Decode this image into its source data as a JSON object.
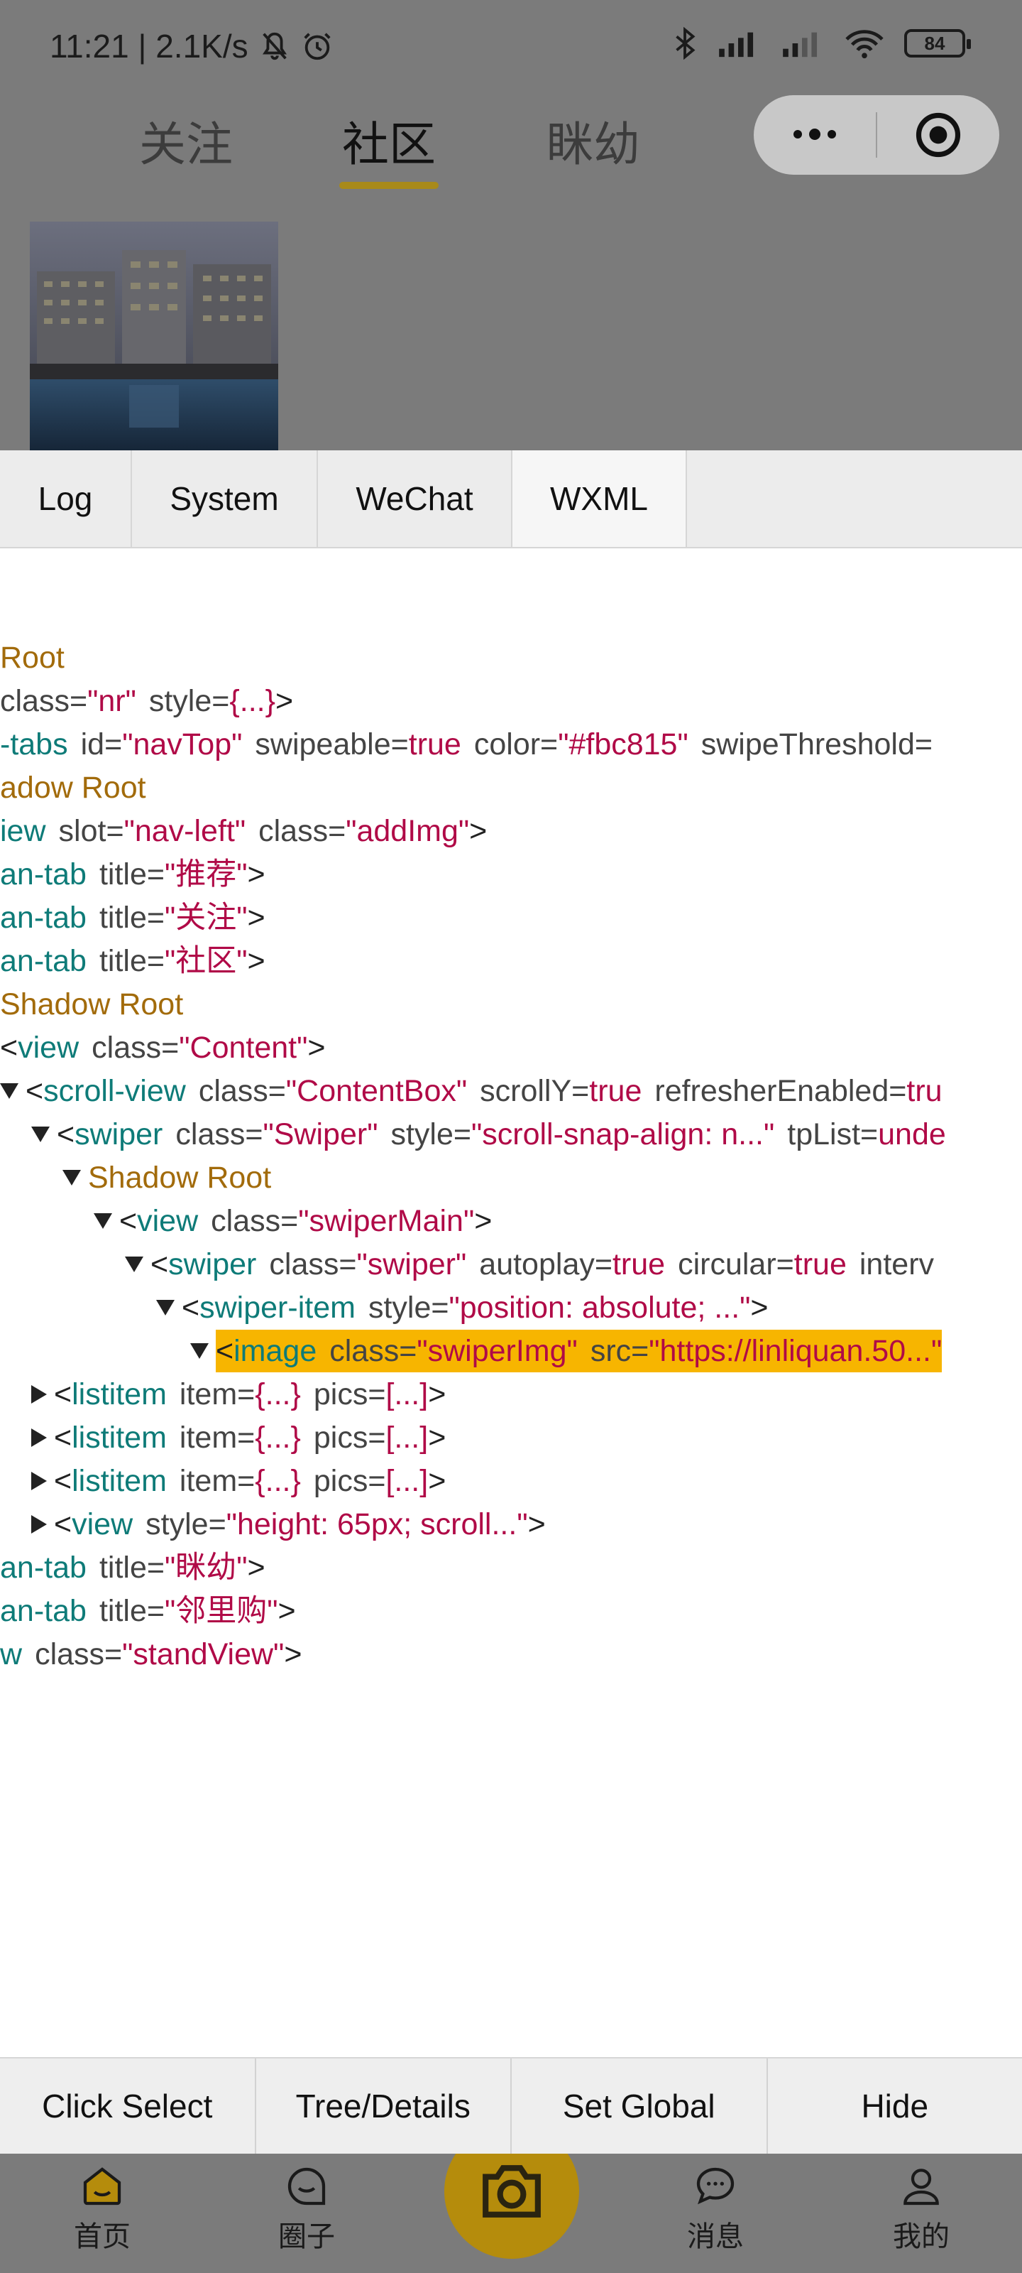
{
  "status_bar": {
    "time_speed": "11:21 | 2.1K/s",
    "battery": "84"
  },
  "nav": {
    "tabs": [
      {
        "label": "关注"
      },
      {
        "label": "社区"
      },
      {
        "label": "眯幼"
      }
    ]
  },
  "vconsole": {
    "tabs": [
      {
        "label": "Log"
      },
      {
        "label": "System"
      },
      {
        "label": "WeChat"
      },
      {
        "label": "WXML"
      }
    ],
    "toolbar": [
      {
        "label": "Click Select"
      },
      {
        "label": "Tree/Details"
      },
      {
        "label": "Set Global"
      },
      {
        "label": "Hide"
      }
    ]
  },
  "tree": {
    "root_label": "Root",
    "view_nr_class": "nr",
    "view_nr_style": "{...}",
    "tabs_tag": "-tabs",
    "tabs_id": "navTop",
    "tabs_swipeable": "true",
    "tabs_color": "#fbc815",
    "tabs_threshold_attr": "swipeThreshold=",
    "shadow_root_1": "adow Root",
    "addimg_tag": "iew",
    "addimg_slot": "nav-left",
    "addimg_class": "addImg",
    "tab_tag": "an-tab",
    "tab_recommend": "推荐",
    "tab_follow": "关注",
    "tab_community": "社区",
    "shadow_root_2": "Shadow Root",
    "content_class": "Content",
    "scroll_class": "ContentBox",
    "scroll_y": "true",
    "scroll_refresher": "tru",
    "swiper_class": "Swiper",
    "swiper_style": "scroll-snap-align: n...",
    "swiper_tplist": "unde",
    "shadow_root_3": "Shadow Root",
    "swiper_main_class": "swiperMain",
    "inner_swiper_class": "swiper",
    "inner_autoplay": "true",
    "inner_circular": "true",
    "inner_interval_attr": "interv",
    "swiper_item_style": "position: absolute; ...",
    "image_class": "swiperImg",
    "image_src": "https://linliquan.50...",
    "listitem_item": "{...}",
    "listitem_pics": "[...]",
    "view_height_style": "height: 65px; scroll...",
    "tab_miyou": "眯幼",
    "tab_linligou": "邻里购",
    "standview_tag": "w",
    "standview_class": "standView"
  },
  "tabbar": {
    "items": [
      {
        "label": "首页"
      },
      {
        "label": "圈子"
      },
      {
        "label": "消息"
      },
      {
        "label": "我的"
      }
    ]
  }
}
